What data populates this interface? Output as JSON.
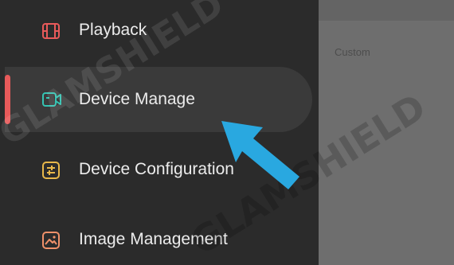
{
  "sidebar": {
    "items": [
      {
        "label": "Playback",
        "icon": "film-icon",
        "color": "#e85a5a"
      },
      {
        "label": "Device Manage",
        "icon": "video-camera-icon",
        "color": "#35c3b2",
        "active": true
      },
      {
        "label": "Device Configuration",
        "icon": "sliders-icon",
        "color": "#e8b84a"
      },
      {
        "label": "Image Management",
        "icon": "image-icon",
        "color": "#f0916a"
      }
    ],
    "active_indicator_color": "#e85a5a"
  },
  "main": {
    "option_label": "Custom"
  },
  "watermark": {
    "text": "GLAMSHIELD"
  },
  "annotation": {
    "arrow_color": "#29a8e0"
  }
}
